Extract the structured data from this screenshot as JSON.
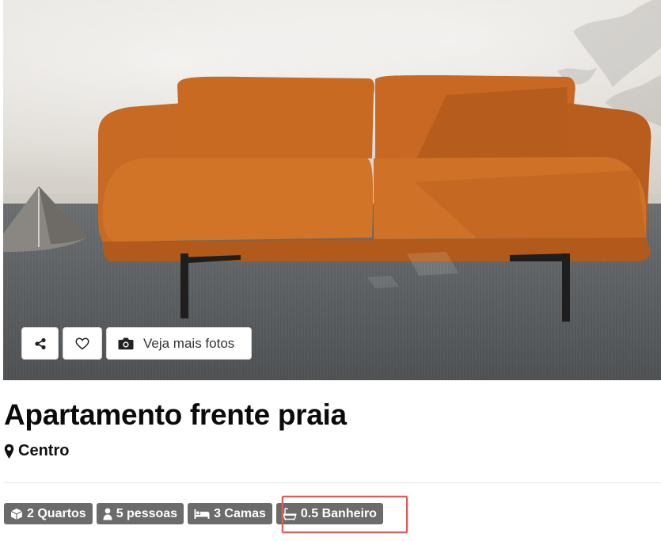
{
  "hero": {
    "image_description": "",
    "actions": {
      "share_icon": "share-icon",
      "favorite_icon": "heart-icon",
      "more_photos_icon": "camera-icon",
      "more_photos_label": "Veja mais fotos"
    }
  },
  "listing": {
    "title": "Apartamento frente praia",
    "location_icon": "map-pin-icon",
    "location": "Centro"
  },
  "features": [
    {
      "icon": "cube-icon",
      "label": "2 Quartos"
    },
    {
      "icon": "user-icon",
      "label": "5 pessoas"
    },
    {
      "icon": "bed-icon",
      "label": "3 Camas"
    },
    {
      "icon": "bath-icon",
      "label": "0.5 Banheiro"
    }
  ],
  "colors": {
    "badge_bg": "#6b6b6b",
    "highlight": "#e05a5a"
  }
}
